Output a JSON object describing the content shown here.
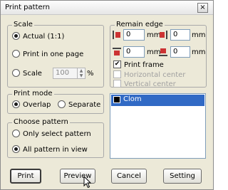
{
  "window": {
    "title": "Print pattern",
    "close_glyph": "×"
  },
  "scale": {
    "title": "Scale",
    "actual": "Actual (1:1)",
    "one_page": "Print in one page",
    "scale_label": "Scale",
    "scale_value": "100",
    "scale_unit": "%",
    "selected": "actual"
  },
  "print_mode": {
    "title": "Print mode",
    "overlap": "Overlap",
    "separate": "Separate",
    "selected": "overlap"
  },
  "choose_pattern": {
    "title": "Choose pattern",
    "only_selected": "Only select pattern",
    "all_in_view": "All pattern in view",
    "selected": "all_in_view"
  },
  "remain_edge": {
    "title": "Remain edge",
    "left_value": "0",
    "right_value": "0",
    "top_value": "0",
    "bottom_value": "0",
    "unit": "mm",
    "print_frame": "Print frame",
    "print_frame_checked": true,
    "horizontal_center": "Horizontal center",
    "vertical_center": "Vertical center",
    "check_glyph": "✔"
  },
  "patterns": [
    {
      "name": "Clom",
      "color": "#000000",
      "selected": true
    }
  ],
  "buttons": {
    "print": "Print",
    "preview": "Preview",
    "cancel": "Cancel",
    "setting": "Setting"
  },
  "icons": {
    "left_edge": "edge-left-icon",
    "right_edge": "edge-right-icon",
    "top_edge": "edge-top-icon",
    "bottom_edge": "edge-bottom-icon",
    "cursor": "mouse-pointer-icon"
  }
}
